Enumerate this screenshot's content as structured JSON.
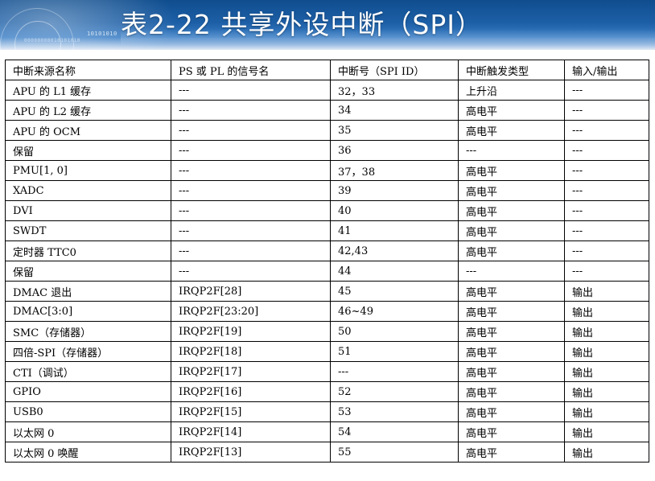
{
  "slide": {
    "title": "表2-22 共享外设中断（SPI）",
    "decoration_binary_1": "10101010",
    "decoration_binary_2": "00000000010101010"
  },
  "table": {
    "columns": [
      "中断来源名称",
      "PS 或 PL 的信号名",
      "中断号（SPI ID）",
      "中断触发类型",
      "输入/输出"
    ],
    "rows": [
      [
        "APU 的 L1 缓存",
        "---",
        "32，33",
        "上升沿",
        "---"
      ],
      [
        "APU 的 L2 缓存",
        "---",
        "34",
        "高电平",
        "---"
      ],
      [
        "APU 的 OCM",
        "---",
        "35",
        "高电平",
        "---"
      ],
      [
        "保留",
        "---",
        "36",
        "---",
        "---"
      ],
      [
        "PMU[1, 0]",
        "---",
        "37，38",
        "高电平",
        "---"
      ],
      [
        "XADC",
        "---",
        "39",
        "高电平",
        "---"
      ],
      [
        "DVI",
        "---",
        "40",
        "高电平",
        "---"
      ],
      [
        "SWDT",
        "---",
        "41",
        "高电平",
        "---"
      ],
      [
        "定时器 TTC0",
        "---",
        "42,43",
        "高电平",
        "---"
      ],
      [
        "保留",
        "---",
        "44",
        "---",
        "---"
      ],
      [
        "DMAC 退出",
        "IRQP2F[28]",
        "45",
        "高电平",
        "输出"
      ],
      [
        "DMAC[3:0]",
        "IRQP2F[23:20]",
        "46~49",
        "高电平",
        "输出"
      ],
      [
        "SMC（存储器）",
        "IRQP2F[19]",
        "50",
        "高电平",
        "输出"
      ],
      [
        "四倍-SPI（存储器）",
        "IRQP2F[18]",
        "51",
        "高电平",
        "输出"
      ],
      [
        "CTI（调试）",
        "IRQP2F[17]",
        "---",
        "高电平",
        "输出"
      ],
      [
        "GPIO",
        "IRQP2F[16]",
        "52",
        "高电平",
        "输出"
      ],
      [
        "USB0",
        "IRQP2F[15]",
        "53",
        "高电平",
        "输出"
      ],
      [
        "以太网 0",
        "IRQP2F[14]",
        "54",
        "高电平",
        "输出"
      ],
      [
        "以太网 0 唤醒",
        "IRQP2F[13]",
        "55",
        "高电平",
        "输出"
      ]
    ]
  },
  "colors": {
    "banner_dark": "#0f4d8e",
    "banner_light": "#3a7ec6",
    "title_text": "#ffffff",
    "table_border": "#000000"
  }
}
